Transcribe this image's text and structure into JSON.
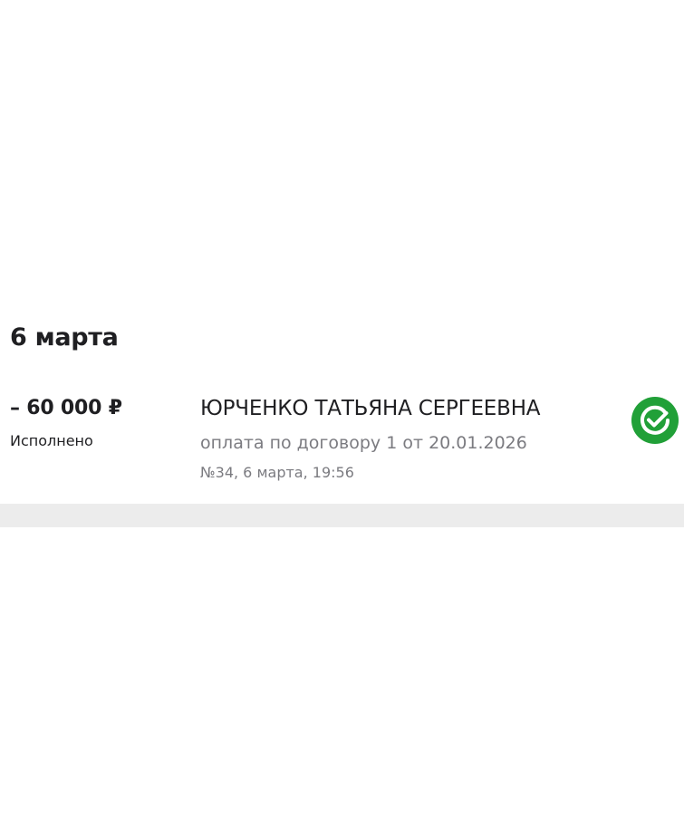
{
  "date_heading": "6 марта",
  "operation": {
    "amount": "– 60 000 ₽",
    "status": "Исполнено",
    "recipient": "ЮРЧЕНКО ТАТЬЯНА СЕРГЕЕВНА",
    "purpose": "оплата по договору 1 от 20.01.2026",
    "meta": "№34, 6 марта, 19:56",
    "icon": "sberbank-logo-icon"
  },
  "colors": {
    "brand_green": "#21a038",
    "text_primary": "#1f1f22",
    "text_secondary": "#7b7b80",
    "divider": "#ececec"
  }
}
